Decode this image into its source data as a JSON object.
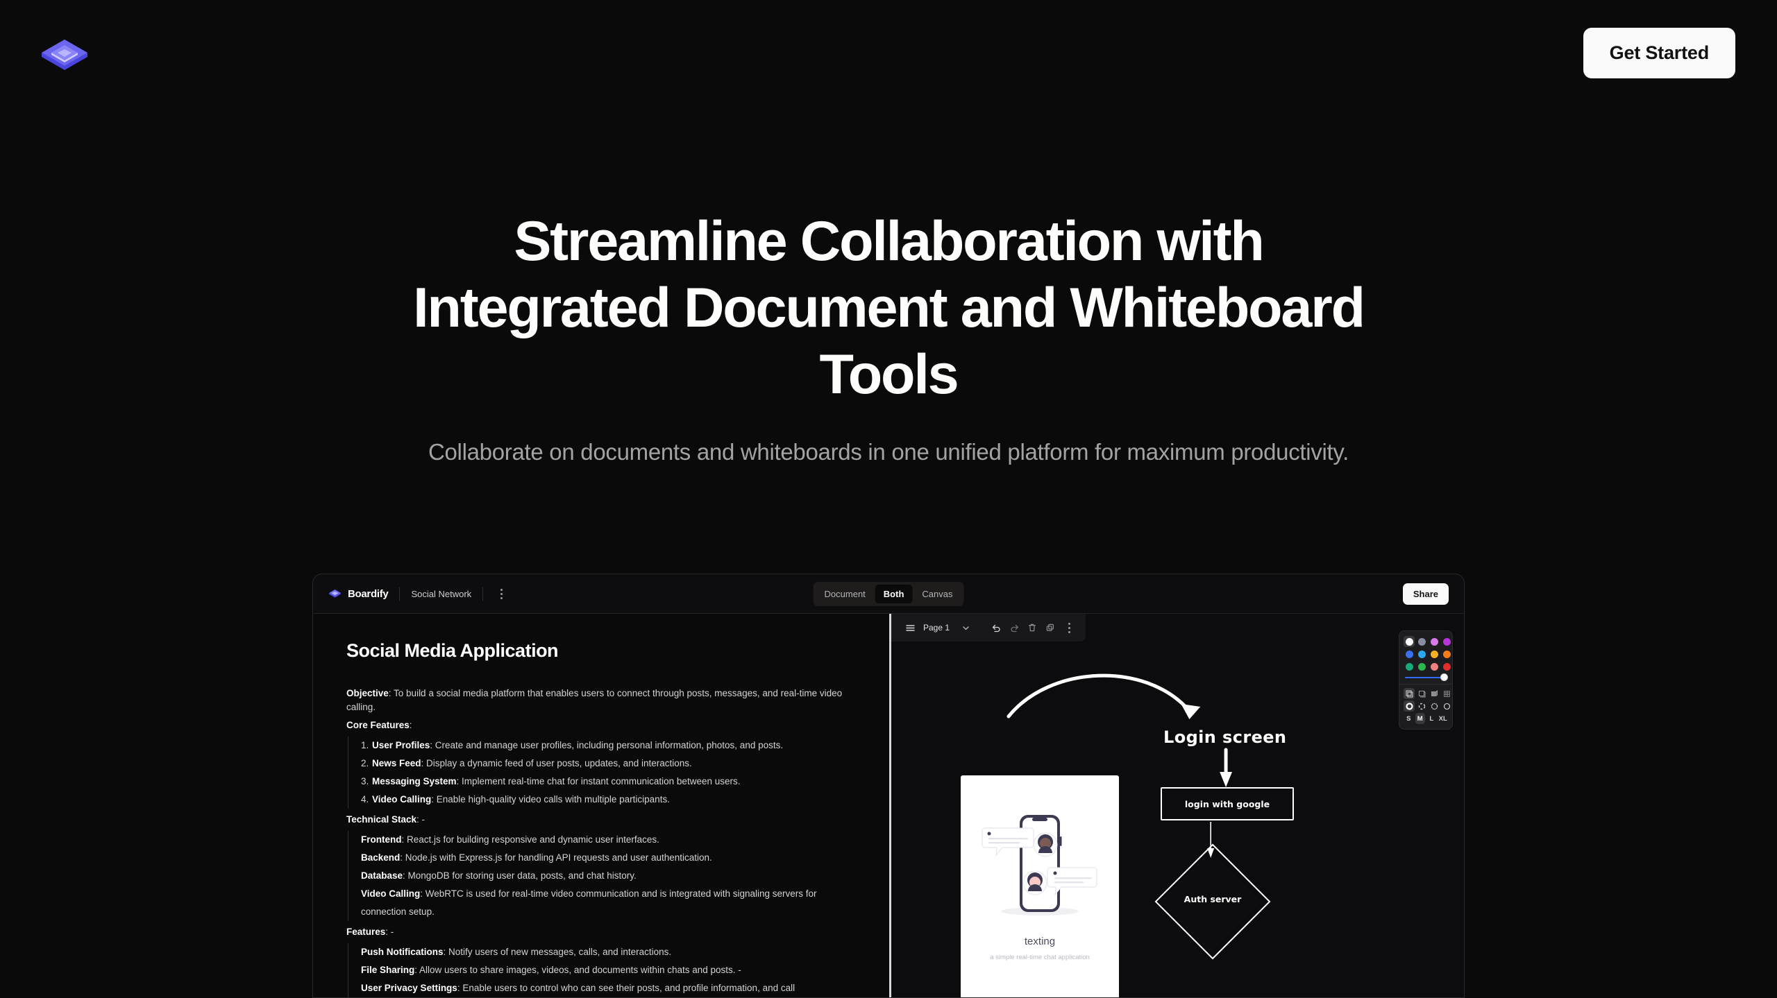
{
  "nav": {
    "logo_icon": "layers-logo-icon",
    "cta_label": "Get Started"
  },
  "hero": {
    "title": "Streamline Collaboration with Integrated Document and Whiteboard Tools",
    "subtitle": "Collaborate on documents and whiteboards in one unified platform for maximum productivity."
  },
  "app": {
    "brand_name": "Boardify",
    "document_title": "Social Network",
    "menu_icon": "kebab-menu-icon",
    "tabs": [
      {
        "label": "Document",
        "active": false
      },
      {
        "label": "Both",
        "active": true
      },
      {
        "label": "Canvas",
        "active": false
      }
    ],
    "share_label": "Share",
    "document": {
      "heading": "Social Media Application",
      "objective_label": "Objective",
      "objective_text": ": To build a social media platform that enables users to connect through posts, messages, and real-time video calling.",
      "core_features_label": "Core Features",
      "core_features_suffix": ":",
      "core_features": [
        {
          "num": "1.",
          "term": "User Profiles",
          "desc": ": Create and manage user profiles, including personal information, photos, and posts."
        },
        {
          "num": "2.",
          "term": "News Feed",
          "desc": ": Display a dynamic feed of user posts, updates, and interactions."
        },
        {
          "num": "3.",
          "term": "Messaging System",
          "desc": ": Implement real-time chat for instant communication between users."
        },
        {
          "num": "4.",
          "term": "Video Calling",
          "desc": ": Enable high-quality video calls with multiple participants."
        }
      ],
      "tech_stack_label": "Technical Stack",
      "tech_stack_suffix": ": -",
      "tech_stack": [
        {
          "term": "Frontend",
          "desc": ": React.js for building responsive and dynamic user interfaces."
        },
        {
          "term": "Backend",
          "desc": ": Node.js with Express.js for handling API requests and user authentication."
        },
        {
          "term": "Database",
          "desc": ": MongoDB for storing user data, posts, and chat history."
        },
        {
          "term": "Video Calling",
          "desc": ": WebRTC is used for real-time video communication and is integrated with signaling servers for connection setup."
        }
      ],
      "features_label": "Features",
      "features_suffix": ": -",
      "features": [
        {
          "term": "Push Notifications",
          "desc": ": Notify users of new messages, calls, and interactions."
        },
        {
          "term": "File Sharing",
          "desc": ": Allow users to share images, videos, and documents within chats and posts. -"
        },
        {
          "term": "User Privacy Settings",
          "desc": ": Enable users to control who can see their posts, and profile information, and call"
        }
      ]
    },
    "canvas_toolbar": {
      "menu_icon": "hamburger-icon",
      "page_label": "Page 1",
      "chevron_icon": "chevron-down-icon",
      "undo_icon": "undo-icon",
      "redo_icon": "redo-icon",
      "delete_icon": "trash-icon",
      "duplicate_icon": "copy-icon",
      "more_icon": "kebab-menu-icon"
    },
    "canvas": {
      "illustration_caption": "texting",
      "illustration_subcaption": "a simple real-time chat application",
      "flow_title": "Login screen",
      "flow_box_label": "login with google",
      "flow_diamond_label": "Auth server"
    },
    "palette": {
      "colors_row1": [
        "#ffffff",
        "#8a8ca3",
        "#d979ec",
        "#b635d8"
      ],
      "colors_row2": [
        "#3a6ff0",
        "#2aa9f0",
        "#f5b223",
        "#f57c17"
      ],
      "colors_row3": [
        "#16a97a",
        "#2cb74d",
        "#f2807f",
        "#e12d2d"
      ],
      "selected_color_index": 0,
      "slider_value": 100,
      "slider_color": "#2f6bff",
      "fill_styles": [
        "transparent-fill-icon",
        "outline-fill-icon",
        "solid-fill-icon",
        "hatch-fill-icon"
      ],
      "selected_fill_index": 0,
      "stroke_styles": [
        "solid-stroke-icon",
        "dashed-stroke-icon",
        "dotted-stroke-icon",
        "thin-stroke-icon"
      ],
      "selected_stroke_index": 0,
      "sizes": [
        "S",
        "M",
        "L",
        "XL"
      ],
      "selected_size": "M"
    }
  },
  "theme": {
    "background": "#0a0a0a",
    "accent": "#6366f1",
    "text_primary": "#fdfdfc",
    "text_muted": "#a3a3a3"
  }
}
